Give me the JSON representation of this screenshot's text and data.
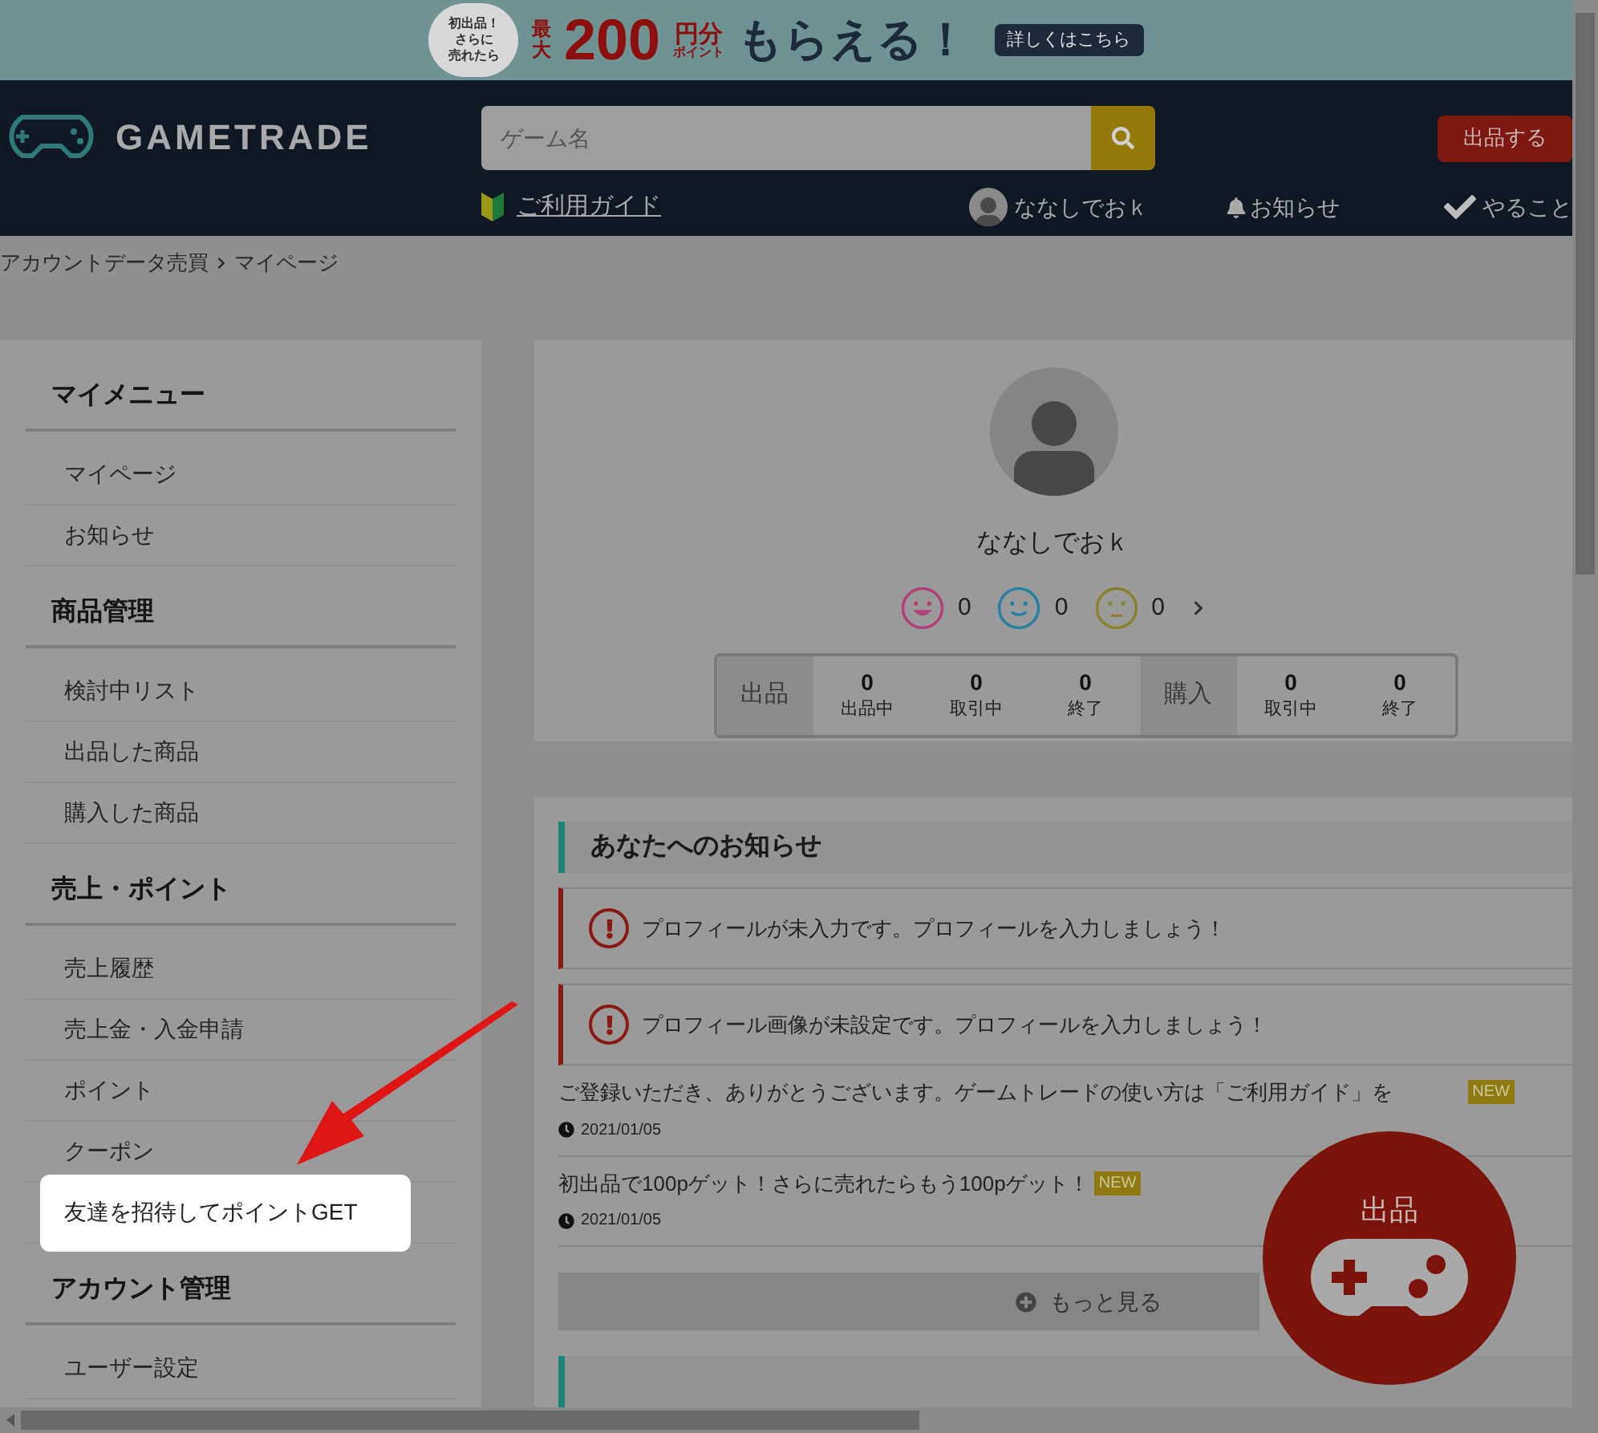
{
  "banner": {
    "bubble": [
      "初出品！",
      "さらに",
      "売れたら"
    ],
    "prefix": [
      "最",
      "大"
    ],
    "amount": "200",
    "unit": "円分",
    "unit_sub": "ポイント",
    "headline": "もらえる！",
    "button": "詳しくはこちら"
  },
  "header": {
    "logo": "GAMETRADE",
    "search": {
      "placeholder": "ゲーム名"
    },
    "sell_button": "出品する",
    "guide": "ご利用ガイド",
    "user": "ななしでおｋ",
    "notifications": "お知らせ",
    "todo": "やること"
  },
  "breadcrumb": [
    "アカウントデータ売買",
    "マイページ"
  ],
  "sidebar": [
    {
      "title": "マイメニュー",
      "items": [
        {
          "label": "マイページ",
          "highlighted": false
        },
        {
          "label": "お知らせ",
          "highlighted": false
        }
      ]
    },
    {
      "title": "商品管理",
      "items": [
        {
          "label": "検討中リスト",
          "highlighted": false
        },
        {
          "label": "出品した商品",
          "highlighted": false
        },
        {
          "label": "購入した商品",
          "highlighted": false
        }
      ]
    },
    {
      "title": "売上・ポイント",
      "items": [
        {
          "label": "売上履歴",
          "highlighted": false
        },
        {
          "label": "売上金・入金申請",
          "highlighted": false
        },
        {
          "label": "ポイント",
          "highlighted": false
        },
        {
          "label": "クーポン",
          "highlighted": false
        },
        {
          "label": "友達を招待してポイントGET",
          "highlighted": true
        }
      ]
    },
    {
      "title": "アカウント管理",
      "items": [
        {
          "label": "ユーザー設定",
          "highlighted": false
        }
      ]
    }
  ],
  "profile": {
    "name": "ななしでおｋ",
    "ratings": [
      {
        "kind": "good",
        "count": "0",
        "color": "#b0407a"
      },
      {
        "kind": "normal",
        "count": "0",
        "color": "#2b7fa0"
      },
      {
        "kind": "bad",
        "count": "0",
        "color": "#8a8030"
      }
    ],
    "stats": [
      {
        "label": "出品",
        "cells": [
          {
            "value": "0",
            "label": "出品中"
          },
          {
            "value": "0",
            "label": "取引中"
          },
          {
            "value": "0",
            "label": "終了"
          }
        ]
      },
      {
        "label": "購入",
        "cells": [
          {
            "value": "0",
            "label": "取引中"
          },
          {
            "value": "0",
            "label": "終了"
          }
        ]
      }
    ]
  },
  "notices": {
    "title": "あなたへのお知らせ",
    "alerts": [
      "プロフィールが未入力です。プロフィールを入力しましょう！",
      "プロフィール画像が未設定です。プロフィールを入力しましょう！"
    ],
    "news": [
      {
        "text": "ご登録いただき、ありがとうございます。ゲームトレードの使い方は「ご利用ガイド」を",
        "badge": "NEW",
        "date": "2021/01/05"
      },
      {
        "text": "初出品で100pゲット！さらに売れたらもう100pゲット！",
        "badge": "NEW",
        "date": "2021/01/05"
      }
    ],
    "more": "もっと見る"
  },
  "fab": {
    "label": "出品"
  }
}
